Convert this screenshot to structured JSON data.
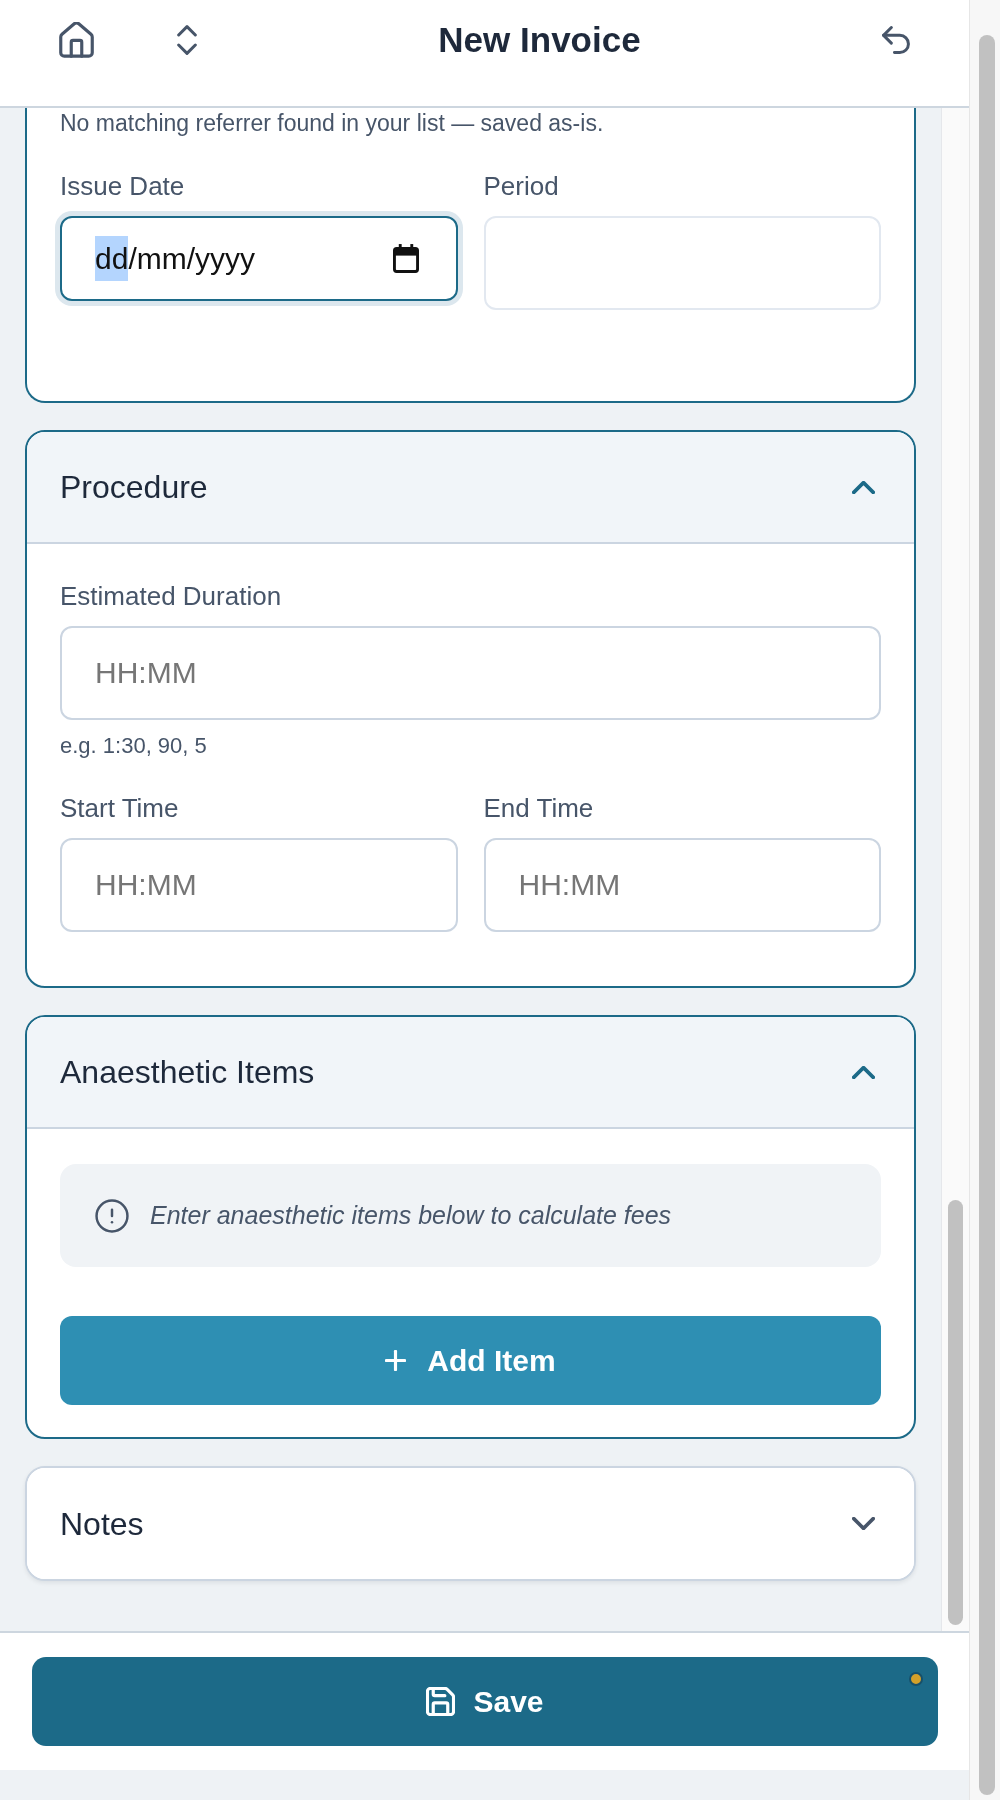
{
  "header": {
    "title": "New Invoice"
  },
  "sections": [
    {
      "kind": "details",
      "blocks": [
        {
          "kind": "note",
          "text": "No matching referrer found in your list — saved as-is."
        },
        {
          "kind": "field_row",
          "fields": [
            {
              "kind": "date",
              "label": "Issue Date",
              "focused": true,
              "segments": [
                {
                  "text": "dd",
                  "selected": true
                },
                {
                  "text": "/mm/yyyy",
                  "selected": false
                }
              ]
            },
            {
              "kind": "text",
              "label": "Period",
              "focused": false,
              "readonly": true
            }
          ]
        }
      ]
    },
    {
      "kind": "collapsible",
      "title": "Procedure",
      "expanded": true,
      "blocks": [
        {
          "kind": "field_row",
          "fields": [
            {
              "kind": "text",
              "label": "Estimated Duration",
              "placeholder": "HH:MM",
              "hint": "e.g. 1:30, 90, 5",
              "focused": false,
              "readonly": false
            }
          ]
        },
        {
          "kind": "field_row",
          "fields": [
            {
              "kind": "text",
              "label": "Start Time",
              "placeholder": "HH:MM",
              "focused": false,
              "readonly": false
            },
            {
              "kind": "text",
              "label": "End Time",
              "placeholder": "HH:MM",
              "focused": false,
              "readonly": false
            }
          ]
        }
      ]
    },
    {
      "kind": "collapsible",
      "title": "Anaesthetic Items",
      "expanded": true,
      "blocks": [
        {
          "kind": "info",
          "text": "Enter anaesthetic items below to calculate fees"
        },
        {
          "kind": "button",
          "label": "Add Item"
        }
      ]
    },
    {
      "kind": "collapsible",
      "title": "Notes",
      "expanded": false
    }
  ],
  "footer": {
    "save_button": {
      "label": "Save",
      "unsaved": true
    }
  }
}
